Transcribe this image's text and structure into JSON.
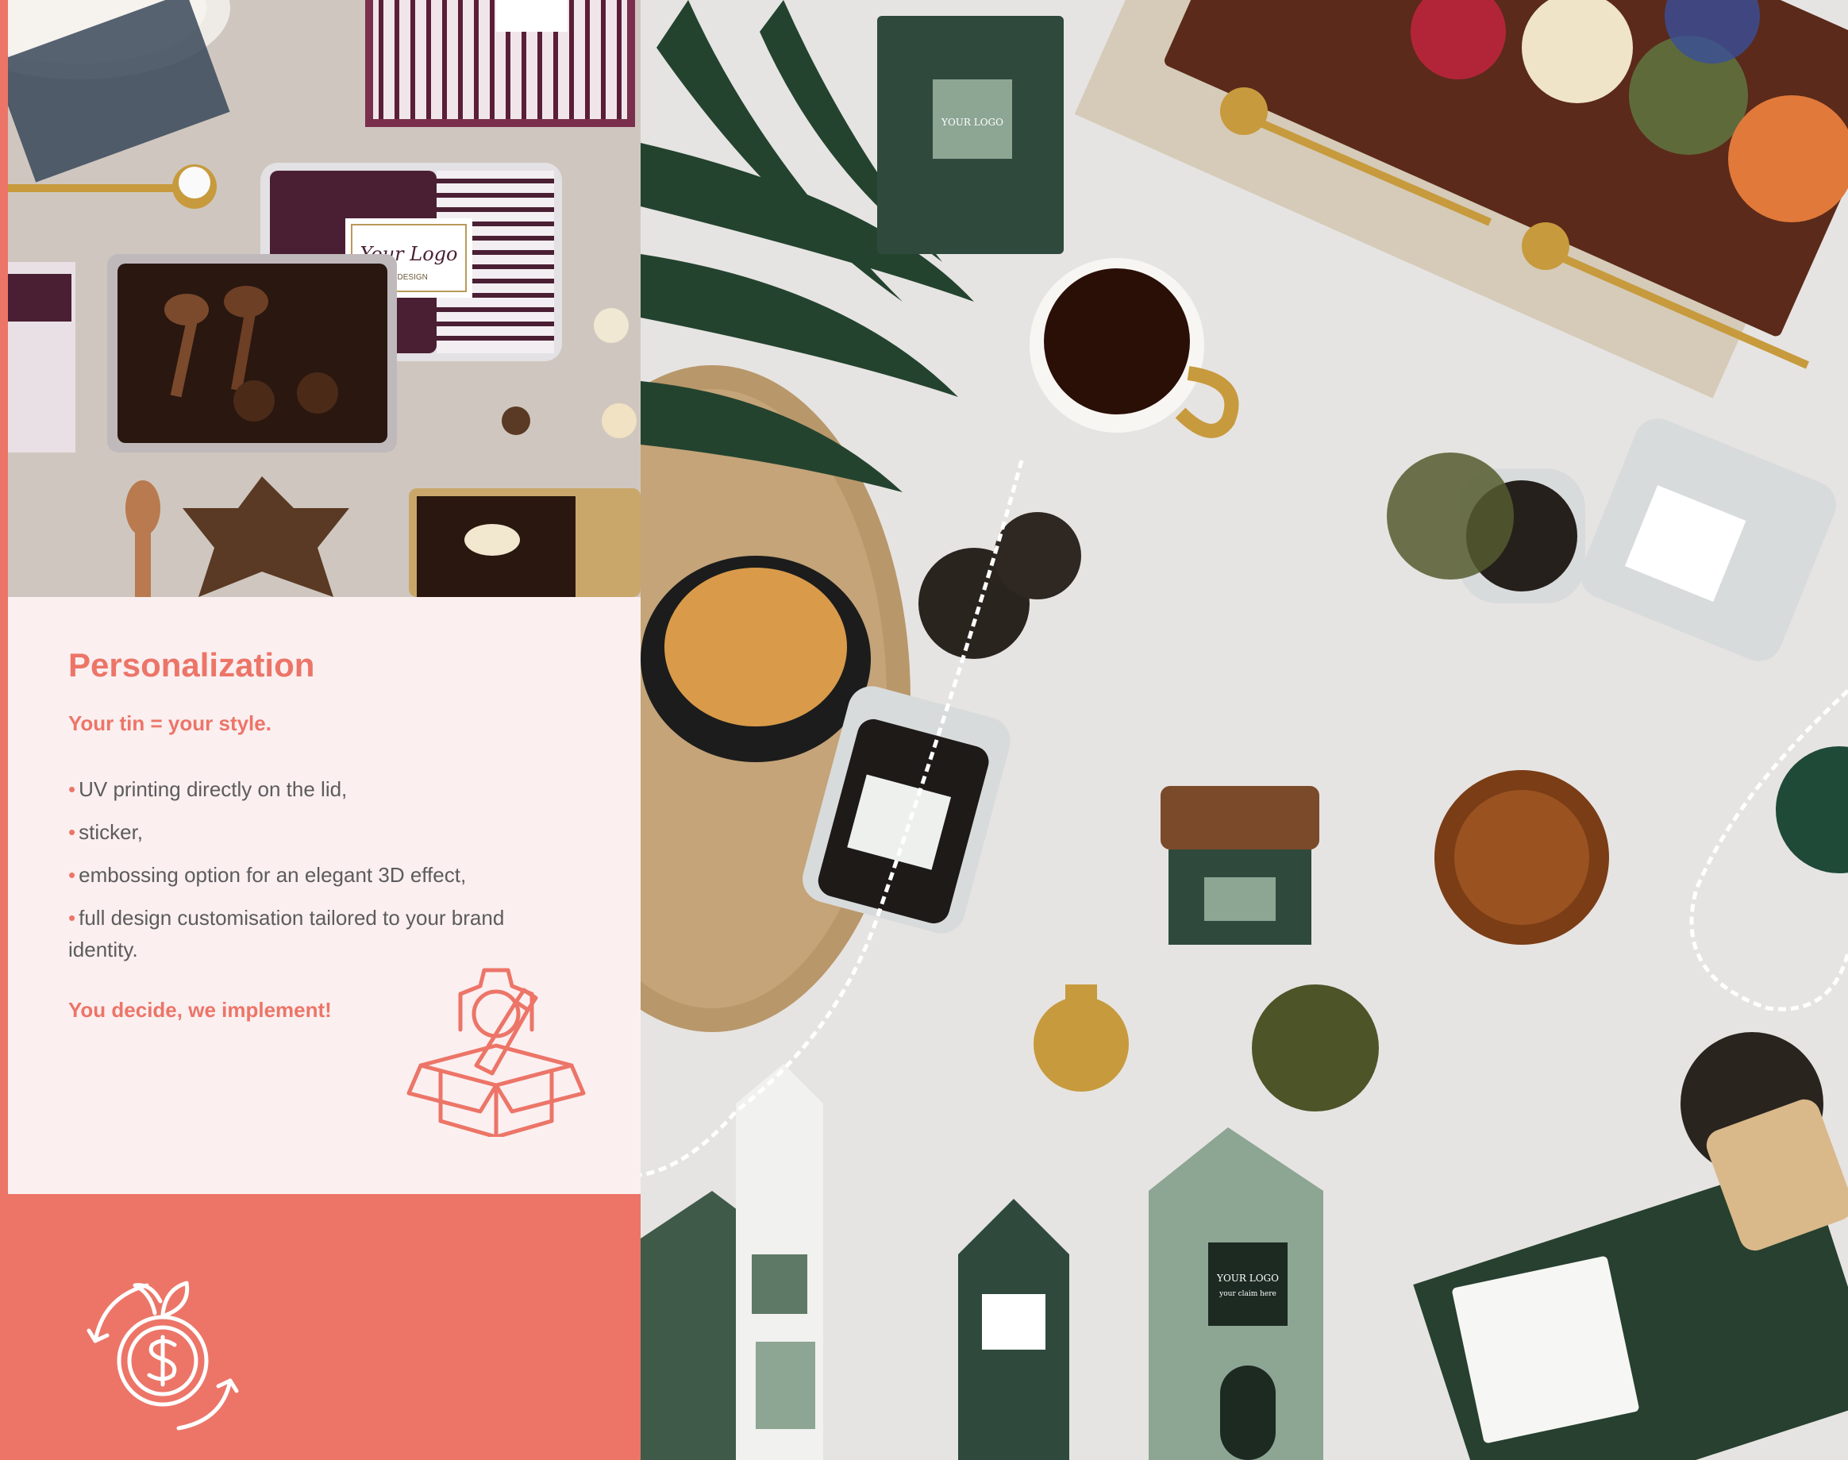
{
  "panel": {
    "heading": "Personalization",
    "subheading": "Your tin = your style.",
    "bullets": [
      "UV printing directly on the lid,",
      "sticker,",
      "embossing option for an elegant 3D effect,",
      "full design customisation tailored to your brand identity."
    ],
    "closing": "You decide, we implement!",
    "icon": "gift-box-gear-icon"
  },
  "bottom_panel": {
    "icon": "money-cycle-icon"
  },
  "photo_left": {
    "box_logo": "Your Logo",
    "box_logo_sub": "& DESIGN"
  },
  "photo_right": {
    "label_logo": "YOUR LOGO",
    "label_claim": "your claim here"
  },
  "colors": {
    "accent": "#ec7568",
    "panel_bg": "#fbeff0",
    "body_text": "#5c5c5c",
    "plum": "#4a1f33",
    "green": "#2f4a3c"
  }
}
